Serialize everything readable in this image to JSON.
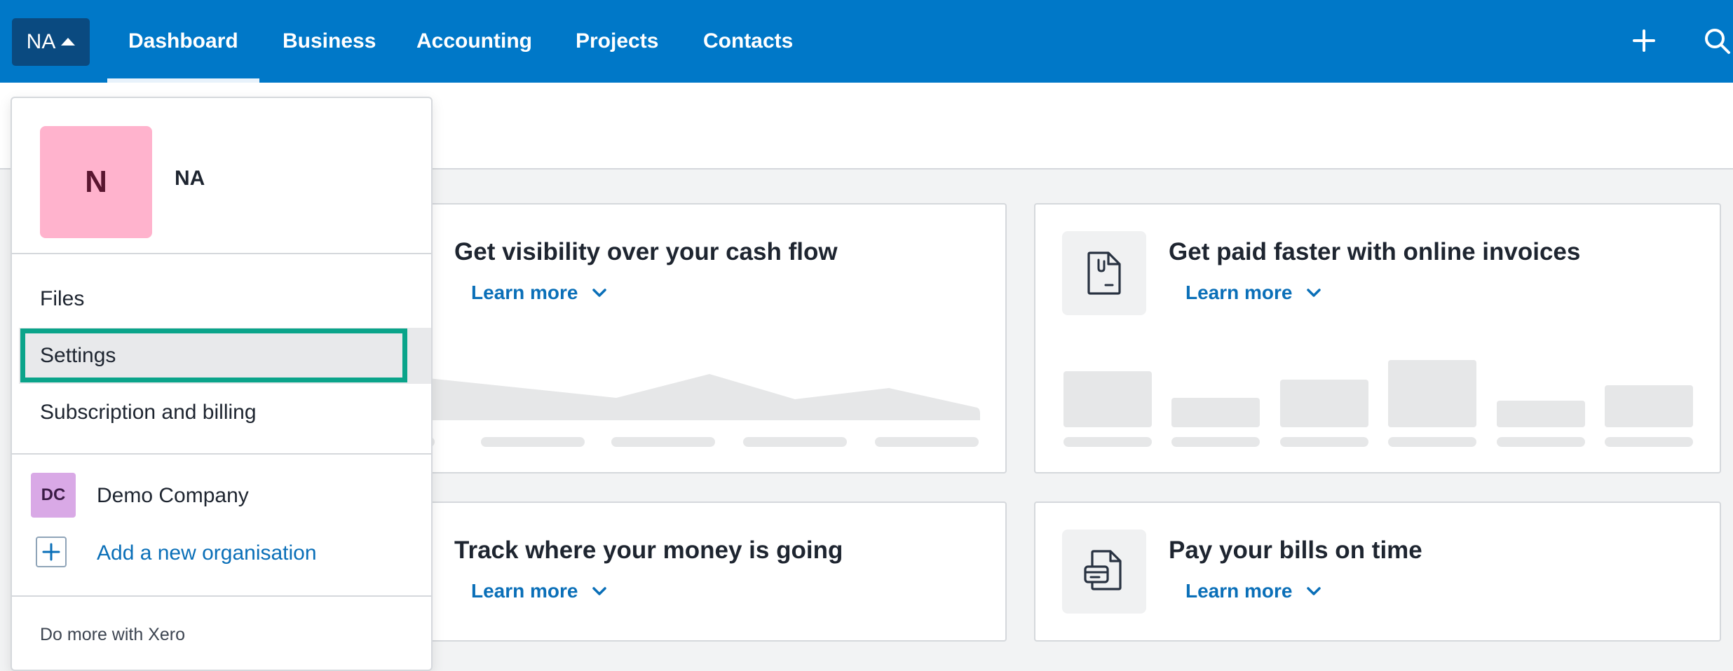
{
  "topnav": {
    "org_short": "NA",
    "tabs": [
      {
        "label": "Dashboard",
        "active": true
      },
      {
        "label": "Business"
      },
      {
        "label": "Accounting"
      },
      {
        "label": "Projects"
      },
      {
        "label": "Contacts"
      }
    ],
    "icons": {
      "add": "plus-icon",
      "search": "search-icon"
    },
    "colors": {
      "nav_bg": "#0078c8",
      "org_btn_bg": "#0a4a80"
    }
  },
  "cards": [
    {
      "title": "Get visibility over your cash flow",
      "link": "Learn more"
    },
    {
      "title": "Get paid faster with online invoices",
      "link": "Learn more",
      "icon": "invoice-icon"
    },
    {
      "title": "Track where your money is going",
      "link": "Learn more"
    },
    {
      "title": "Pay your bills on time",
      "link": "Learn more",
      "icon": "bill-icon"
    }
  ],
  "dropdown": {
    "avatar_initial": "N",
    "profile_name": "NA",
    "items": [
      {
        "label": "Files"
      },
      {
        "label": "Settings",
        "highlighted": true
      },
      {
        "label": "Subscription and billing"
      }
    ],
    "organisation": {
      "initials": "DC",
      "name": "Demo Company"
    },
    "add_org": "Add a new organisation",
    "footer": "Do more with Xero",
    "colors": {
      "avatar_bg": "#ffb3cd",
      "org_avatar_bg": "#d9a9e6",
      "highlight_border": "#0aa48a",
      "link": "#0a6fb8"
    }
  }
}
